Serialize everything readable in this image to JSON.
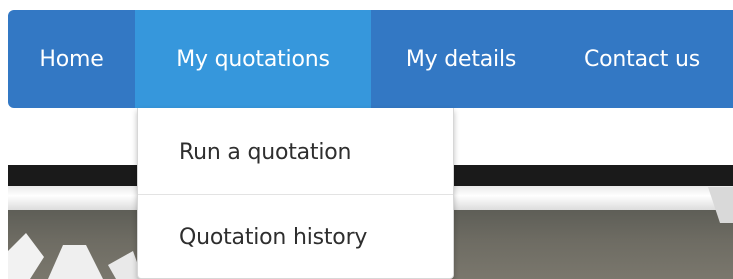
{
  "navbar": {
    "items": [
      {
        "label": "Home"
      },
      {
        "label": "My quotations",
        "active": true
      },
      {
        "label": "My details"
      },
      {
        "label": "Contact us"
      }
    ],
    "colors": {
      "background": "#3378c4",
      "active_background": "#3697dc",
      "text": "#ffffff"
    }
  },
  "dropdown": {
    "items": [
      {
        "label": "Run a quotation"
      },
      {
        "label": "Quotation history"
      }
    ],
    "colors": {
      "background": "#ffffff",
      "text": "#2e2e2e"
    }
  }
}
